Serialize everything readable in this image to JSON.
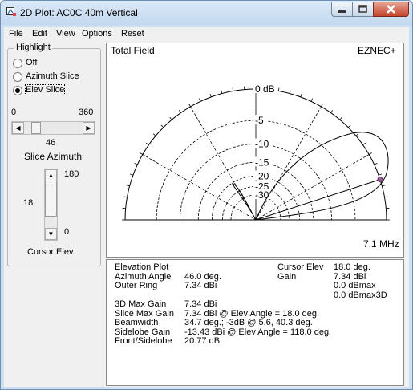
{
  "window": {
    "title": "2D Plot: AC0C 40m Vertical"
  },
  "menu": [
    "File",
    "Edit",
    "View",
    "Options",
    "Reset"
  ],
  "highlight": {
    "legend": "Highlight",
    "options": [
      {
        "label": "Off",
        "selected": false
      },
      {
        "label": "Azimuth Slice",
        "selected": false
      },
      {
        "label": "Elev Slice",
        "selected": true
      }
    ]
  },
  "azimuth_slider": {
    "min_label": "0",
    "max_label": "360",
    "value": "46",
    "caption": "Slice Azimuth"
  },
  "elev_slider": {
    "top_label": "180",
    "bottom_label": "0",
    "value": "18",
    "caption": "Cursor Elev"
  },
  "plot": {
    "title": "Total Field",
    "brand": "EZNEC+",
    "frequency": "7.1 MHz",
    "ring_labels": [
      "0 dB",
      "-5",
      "-10",
      "-15",
      "-20",
      "-25",
      "-30"
    ]
  },
  "info": {
    "left_rows": [
      {
        "label": "Elevation Plot",
        "value": ""
      },
      {
        "label": "Azimuth Angle",
        "value": "46.0 deg."
      },
      {
        "label": "Outer Ring",
        "value": "7.34 dBi"
      },
      {
        "label": "",
        "value": ""
      },
      {
        "label": "3D Max Gain",
        "value": "7.34 dBi"
      },
      {
        "label": "Slice Max Gain",
        "value": "7.34 dBi @ Elev Angle = 18.0 deg."
      },
      {
        "label": "Beamwidth",
        "value": "34.7 deg.; -3dB @ 5.6, 40.3 deg."
      },
      {
        "label": "Sidelobe Gain",
        "value": "-13.43 dBi @ Elev Angle = 118.0 deg."
      },
      {
        "label": "Front/Sidelobe",
        "value": "20.77 dB"
      }
    ],
    "right_rows": [
      {
        "label": "Cursor Elev",
        "value": "18.0 deg."
      },
      {
        "label": "Gain",
        "value": "7.34 dBi"
      },
      {
        "label": "",
        "value": "0.0 dBmax"
      },
      {
        "label": "",
        "value": "0.0 dBmax3D"
      }
    ]
  }
}
